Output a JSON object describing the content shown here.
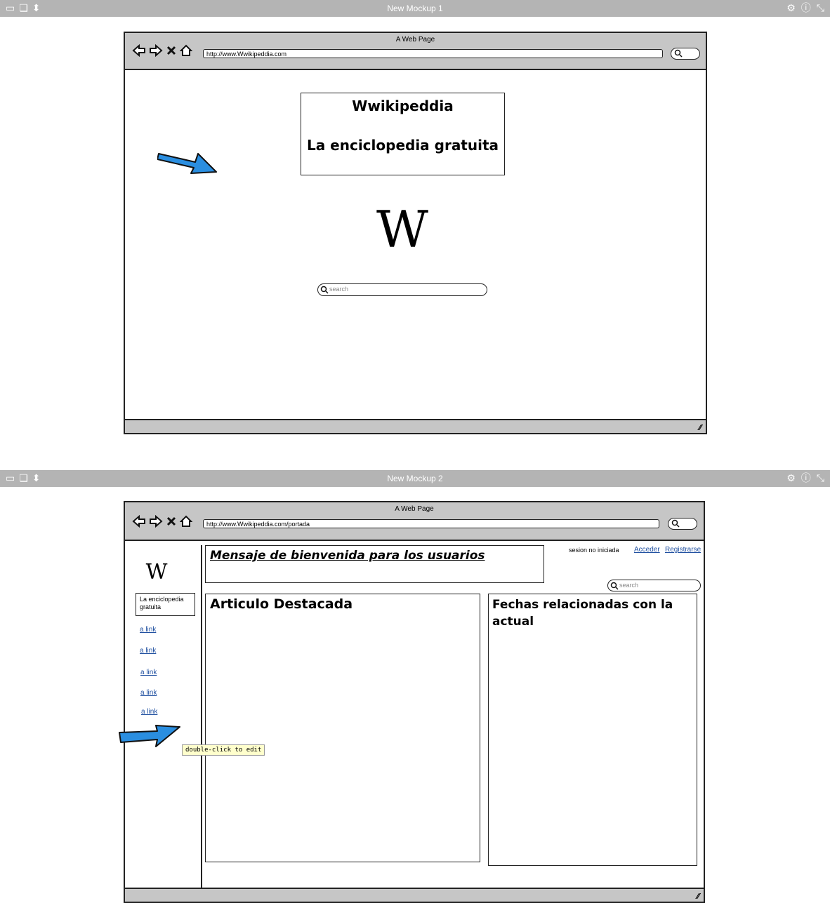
{
  "mockup1": {
    "tab_title": "New Mockup 1",
    "window_title": "A Web Page",
    "url": "http://www.Wwikipeddia.com",
    "header_title": "Wwikipeddia",
    "header_subtitle": "La enciclopedia gratuita",
    "logo": "W",
    "search_placeholder": "search"
  },
  "mockup2": {
    "tab_title": "New Mockup 2",
    "window_title": "A Web Page",
    "url": "http://www.Wwikipeddia.com/portada",
    "logo": "W",
    "tagline": "La enciclopedia gratuita",
    "sidebar_links": [
      "a link",
      "a link",
      "a link",
      "a link",
      "a link"
    ],
    "welcome": "Mensaje de bienvenida para los usuarios",
    "session_status": "sesion no iniciada",
    "login": "Acceder",
    "register": "Registrarse",
    "search_placeholder": "search",
    "featured_title": "Articulo Destacada",
    "related_title": "Fechas relacionadas con la actual",
    "tooltip": "double-click to edit"
  },
  "colors": {
    "arrow": "#2a8ee0",
    "link": "#2050a0",
    "toolbar": "#b4b4b4"
  },
  "icons": [
    "back-arrow-icon",
    "forward-arrow-icon",
    "stop-icon",
    "home-icon",
    "search-icon",
    "gear-icon",
    "info-icon",
    "collapse-icon",
    "resize-grip-icon"
  ]
}
